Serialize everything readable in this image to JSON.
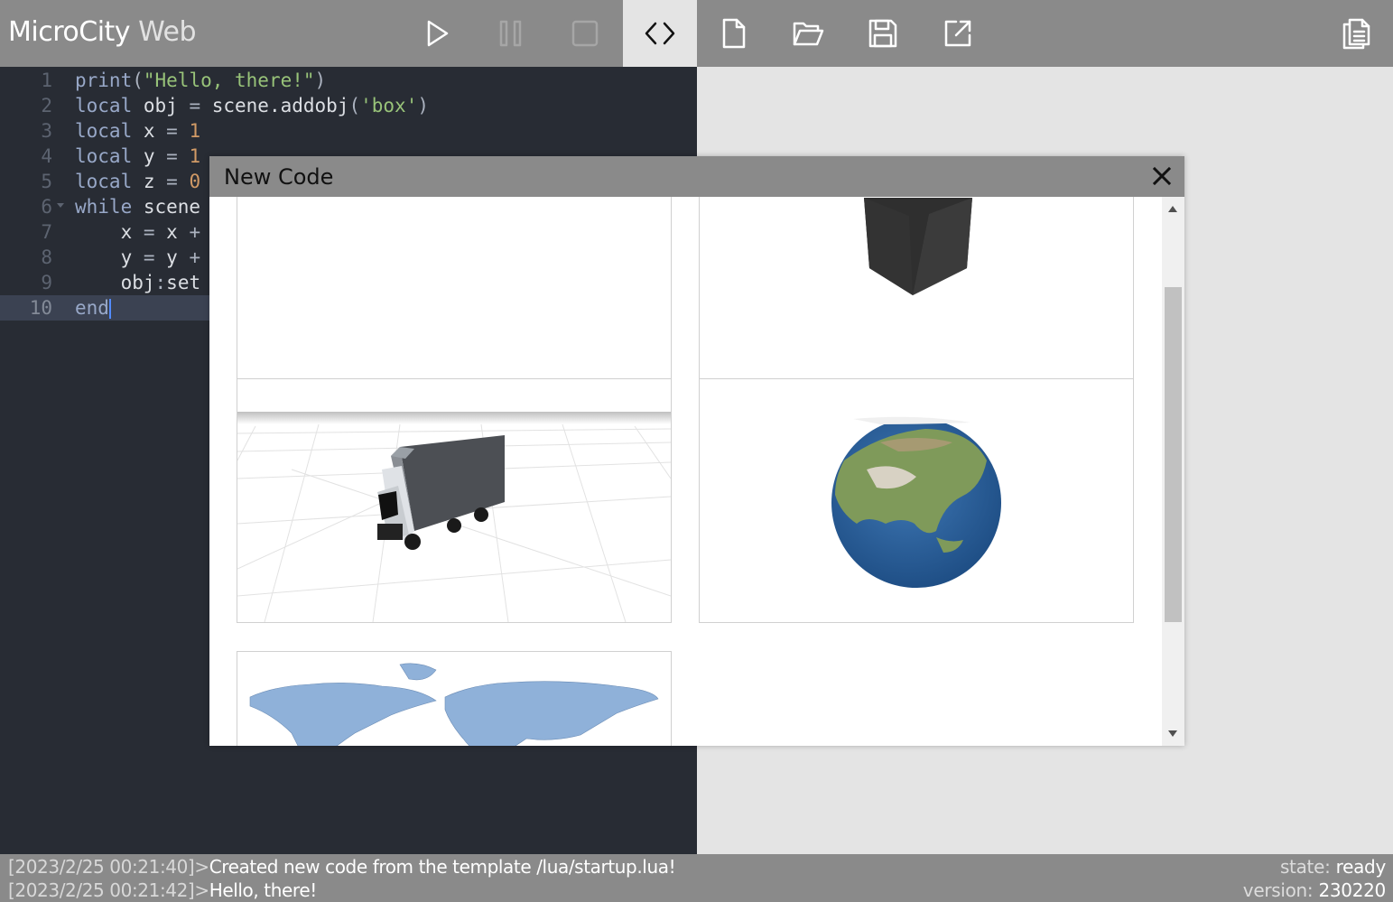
{
  "app": {
    "title_part1": "MicroCity",
    "title_part2": "Web"
  },
  "toolbar": {
    "buttons": [
      {
        "name": "run-button",
        "icon": "play-icon",
        "state": "enabled"
      },
      {
        "name": "pause-button",
        "icon": "pause-icon",
        "state": "disabled"
      },
      {
        "name": "stop-button",
        "icon": "stop-icon",
        "state": "disabled"
      },
      {
        "name": "code-view-button",
        "icon": "code-icon",
        "state": "active"
      },
      {
        "name": "new-file-button",
        "icon": "new-file-icon",
        "state": "enabled"
      },
      {
        "name": "open-folder-button",
        "icon": "folder-open-icon",
        "state": "enabled"
      },
      {
        "name": "save-button",
        "icon": "save-icon",
        "state": "enabled"
      },
      {
        "name": "export-button",
        "icon": "external-link-icon",
        "state": "enabled"
      },
      {
        "name": "docs-button",
        "icon": "documents-icon",
        "state": "enabled"
      }
    ]
  },
  "editor": {
    "current_line": 10,
    "lines": [
      {
        "n": "1",
        "tokens": [
          [
            "fn",
            "print"
          ],
          [
            "op",
            "("
          ],
          [
            "str",
            "\"Hello, there!\""
          ],
          [
            "op",
            ")"
          ]
        ]
      },
      {
        "n": "2",
        "tokens": [
          [
            "kw2",
            "local"
          ],
          [
            "id",
            " obj "
          ],
          [
            "op",
            "="
          ],
          [
            "id",
            " scene.addobj"
          ],
          [
            "op",
            "("
          ],
          [
            "str",
            "'box'"
          ],
          [
            "op",
            ")"
          ]
        ]
      },
      {
        "n": "3",
        "tokens": [
          [
            "kw2",
            "local"
          ],
          [
            "id",
            " x "
          ],
          [
            "op",
            "="
          ],
          [
            "num",
            " 1"
          ]
        ]
      },
      {
        "n": "4",
        "tokens": [
          [
            "kw2",
            "local"
          ],
          [
            "id",
            " y "
          ],
          [
            "op",
            "="
          ],
          [
            "num",
            " 1"
          ]
        ]
      },
      {
        "n": "5",
        "tokens": [
          [
            "kw2",
            "local"
          ],
          [
            "id",
            " z "
          ],
          [
            "op",
            "="
          ],
          [
            "num",
            " 0"
          ]
        ]
      },
      {
        "n": "6",
        "fold": true,
        "tokens": [
          [
            "kw2",
            "while"
          ],
          [
            "id",
            " scene"
          ]
        ]
      },
      {
        "n": "7",
        "tokens": [
          [
            "id",
            "    x "
          ],
          [
            "op",
            "="
          ],
          [
            "id",
            " x "
          ],
          [
            "op",
            "+"
          ]
        ]
      },
      {
        "n": "8",
        "tokens": [
          [
            "id",
            "    y "
          ],
          [
            "op",
            "="
          ],
          [
            "id",
            " y "
          ],
          [
            "op",
            "+"
          ]
        ]
      },
      {
        "n": "9",
        "tokens": [
          [
            "id",
            "    obj"
          ],
          [
            "op",
            ":"
          ],
          [
            "id",
            "set"
          ]
        ]
      },
      {
        "n": "10",
        "tokens": [
          [
            "kw2",
            "end"
          ]
        ]
      }
    ],
    "colors": {
      "background": "#282c34",
      "current_line": "#3b4252",
      "string": "#98c379",
      "number": "#d19a66",
      "keyword": "#98a8c8"
    }
  },
  "modal": {
    "title": "New Code",
    "templates": [
      {
        "name": "template-blank",
        "preview": "blank"
      },
      {
        "name": "template-box",
        "preview": "box-3d"
      },
      {
        "name": "template-truck",
        "preview": "truck-3d"
      },
      {
        "name": "template-earth",
        "preview": "globe-3d"
      },
      {
        "name": "template-world-map",
        "preview": "world-map"
      }
    ]
  },
  "status": {
    "log": [
      {
        "time": "[2023/2/25 00:21:40]>",
        "message": "Created new code from the template /lua/startup.lua!"
      },
      {
        "time": "[2023/2/25 00:21:42]>",
        "message": "Hello, there!"
      }
    ],
    "state_label": "state:",
    "state_value": "ready",
    "version_label": "version:",
    "version_value": "230220"
  }
}
